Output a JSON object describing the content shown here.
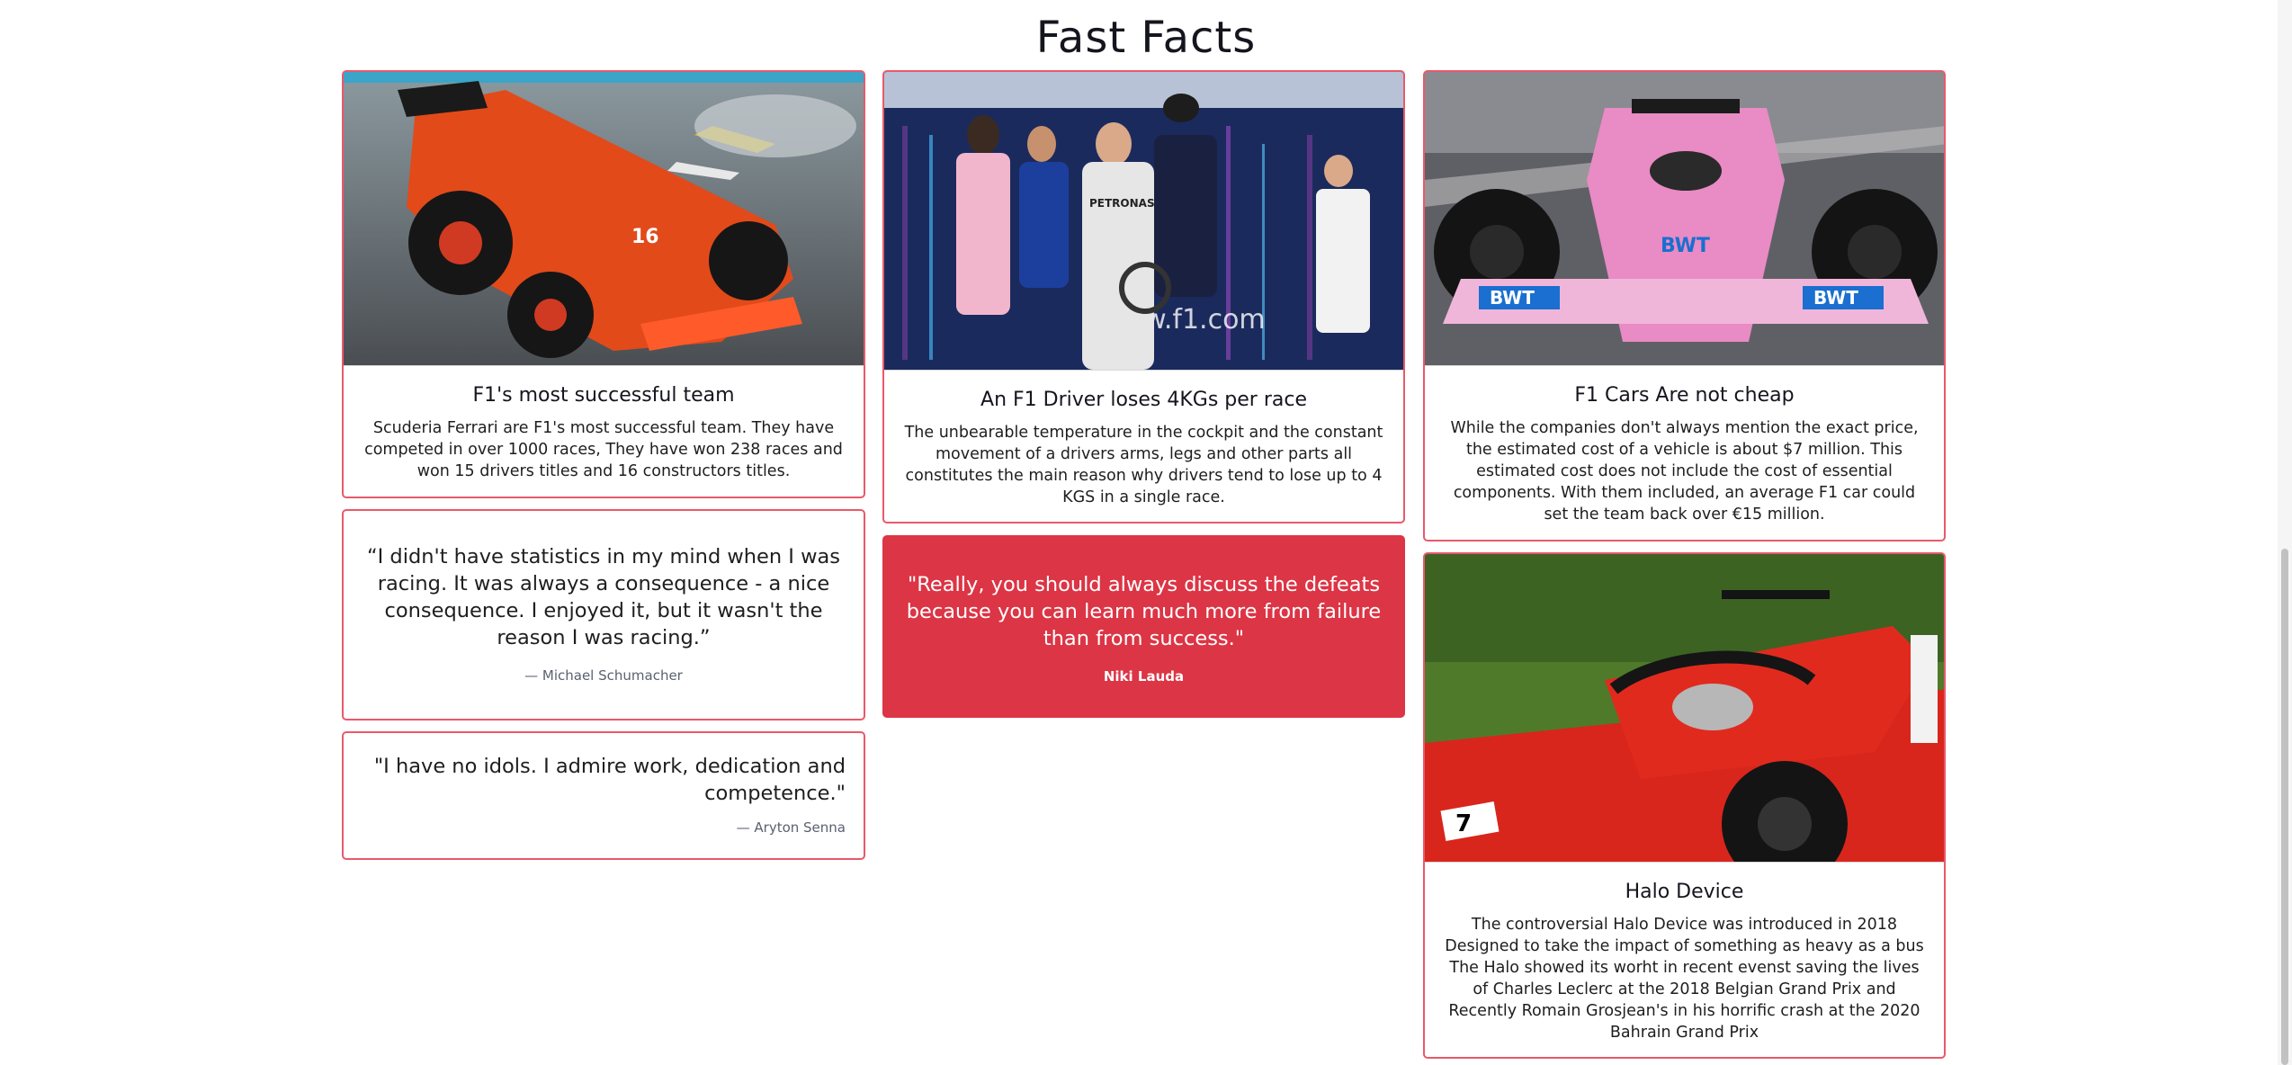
{
  "page": {
    "title": "Fast Facts"
  },
  "cards": {
    "ferrari": {
      "image_alt": "Ferrari F1 car doing donuts",
      "title": "F1's most successful team",
      "text": "Scuderia Ferrari are F1's most successful team. They have competed in over 1000 races, They have won 238 races and won 15 drivers titles and 16 constructors titles."
    },
    "driver": {
      "image_alt": "F1 drivers after race",
      "title": "An F1 Driver loses 4KGs per race",
      "text": "The unbearable temperature in the cockpit and the constant movement of a drivers arms, legs and other parts all constitutes the main reason why drivers tend to lose up to 4 KGS in a single race."
    },
    "cost": {
      "image_alt": "Pink Racing Point F1 car",
      "title": "F1 Cars Are not cheap",
      "text": "While the companies don't always mention the exact price, the estimated cost of a vehicle is about $7 million. This estimated cost does not include the cost of essential components. With them included, an average F1 car could set the team back over €15 million."
    },
    "halo": {
      "image_alt": "Ferrari F1 car with halo device",
      "title": "Halo Device",
      "text": "The controversial Halo Device was introduced in 2018 Designed to take the impact of something as heavy as a bus The Halo showed its worht in recent evenst saving the lives of Charles Leclerc at the 2018 Belgian Grand Prix and Recently Romain Grosjean's in his horrific crash at the 2020 Bahrain Grand Prix"
    }
  },
  "quotes": {
    "schumacher": {
      "text": "“I didn't have statistics in my mind when I was racing. It was always a consequence - a nice consequence. I enjoyed it, but it wasn't the reason I was racing.”",
      "author": "— Michael Schumacher"
    },
    "lauda": {
      "text": "\"Really, you should always discuss the defeats because you can learn much more from failure than from success.\"",
      "author": "Niki Lauda"
    },
    "senna": {
      "text": "\"I have no idols. I admire work, dedication and competence.\"",
      "author": "— Aryton Senna"
    }
  },
  "colors": {
    "border": "#e8596b",
    "accent_red": "#dc3545",
    "text": "#1e1e1e"
  }
}
